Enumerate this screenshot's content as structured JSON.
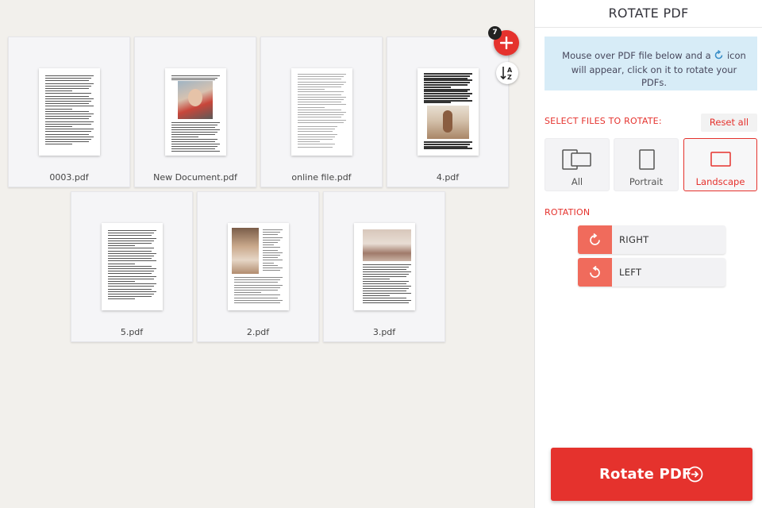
{
  "sidebar": {
    "title": "ROTATE PDF",
    "info_part1": "Mouse over PDF file below and a",
    "info_part2": "icon will appear, click on it to rotate your PDFs.",
    "select_label": "SELECT FILES TO ROTATE:",
    "reset_label": "Reset all",
    "filters": [
      {
        "label": "All",
        "active": false
      },
      {
        "label": "Portrait",
        "active": false
      },
      {
        "label": "Landscape",
        "active": true
      }
    ],
    "rotation_label": "ROTATION",
    "rotate_right_label": "RIGHT",
    "rotate_left_label": "LEFT",
    "submit_label": "Rotate PDF"
  },
  "workspace": {
    "file_count_badge": "7",
    "files": [
      {
        "name": "0003.pdf",
        "thumbnail": "text-page"
      },
      {
        "name": "New Document.pdf",
        "thumbnail": "text-with-portrait-photo"
      },
      {
        "name": "online file.pdf",
        "thumbnail": "light-text-page"
      },
      {
        "name": "4.pdf",
        "thumbnail": "text-with-photo"
      },
      {
        "name": "5.pdf",
        "thumbnail": "text-page"
      },
      {
        "name": "2.pdf",
        "thumbnail": "photo-with-two-column-text"
      },
      {
        "name": "3.pdf",
        "thumbnail": "photo-top-with-text"
      }
    ]
  },
  "colors": {
    "accent": "#e5322d",
    "info_bg": "#d7ecf7",
    "rotate_icon_bg": "#f06b5c"
  },
  "icons": {
    "add": "plus-icon",
    "sort": "sort-az-icon",
    "rotate_right": "rotate-clockwise-icon",
    "rotate_left": "rotate-counterclockwise-icon",
    "submit": "arrow-circle-right-icon"
  }
}
